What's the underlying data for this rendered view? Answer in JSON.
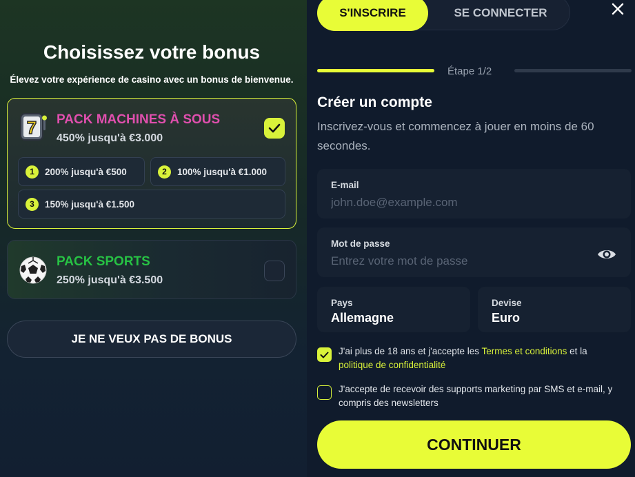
{
  "bonus": {
    "title": "Choisissez votre bonus",
    "subtitle": "Élevez votre expérience de casino avec un bonus de bienvenue.",
    "packs": [
      {
        "title": "PACK MACHINES À SOUS",
        "title_color": "#e04fae",
        "amount": "450% jusqu'à €3.000",
        "selected": true,
        "icon": "slot-machine-icon",
        "tiers": [
          {
            "num": "1",
            "label": "200% jusqu'à €500"
          },
          {
            "num": "2",
            "label": "100% jusqu'à €1.000"
          },
          {
            "num": "3",
            "label": "150% jusqu'à €1.500"
          }
        ]
      },
      {
        "title": "PACK SPORTS",
        "title_color": "#27c244",
        "amount": "250% jusqu'à €3.500",
        "selected": false,
        "icon": "soccer-ball-icon"
      }
    ],
    "no_bonus_label": "JE NE VEUX PAS DE BONUS"
  },
  "auth": {
    "tabs": {
      "signup": "S'INSCRIRE",
      "login": "SE CONNECTER"
    },
    "step_label": "Étape 1/2",
    "form_title": "Créer un compte",
    "form_desc": "Inscrivez-vous et commencez à jouer en moins de 60 secondes.",
    "email": {
      "label": "E-mail",
      "placeholder": "john.doe@example.com",
      "value": ""
    },
    "password": {
      "label": "Mot de passe",
      "placeholder": "Entrez votre mot de passe",
      "value": ""
    },
    "country": {
      "label": "Pays",
      "value": "Allemagne"
    },
    "currency": {
      "label": "Devise",
      "value": "Euro"
    },
    "consent_terms": {
      "checked": true,
      "text_before": "J'ai plus de 18 ans et j'accepte les ",
      "link_terms": "Termes et conditions",
      "text_mid": " et la ",
      "link_privacy": "politique de confidentialité"
    },
    "consent_marketing": {
      "checked": false,
      "text": "J'accepte de recevoir des supports marketing par SMS et e-mail, y compris des newsletters"
    },
    "continue_label": "CONTINUER"
  },
  "colors": {
    "accent": "#e8fc37",
    "background": "#101b2c"
  }
}
